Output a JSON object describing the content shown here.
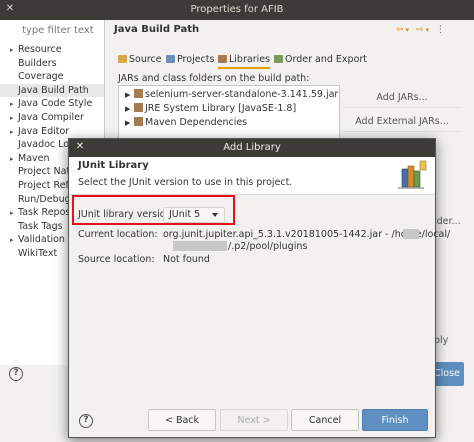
{
  "window": {
    "title": "Properties for AFIB",
    "filter_placeholder": "type filter text",
    "tree": [
      {
        "label": "Resource",
        "arrow": "▸"
      },
      {
        "label": "Builders",
        "arrow": ""
      },
      {
        "label": "Coverage",
        "arrow": ""
      },
      {
        "label": "Java Build Path",
        "arrow": "",
        "selected": true
      },
      {
        "label": "Java Code Style",
        "arrow": "▸"
      },
      {
        "label": "Java Compiler",
        "arrow": "▸"
      },
      {
        "label": "Java Editor",
        "arrow": "▸"
      },
      {
        "label": "Javadoc Locat",
        "arrow": ""
      },
      {
        "label": "Maven",
        "arrow": "▸"
      },
      {
        "label": "Project Natur",
        "arrow": ""
      },
      {
        "label": "Project Refer",
        "arrow": ""
      },
      {
        "label": "Run/Debug Se",
        "arrow": ""
      },
      {
        "label": "Task Reposito",
        "arrow": "▸"
      },
      {
        "label": "Task Tags",
        "arrow": ""
      },
      {
        "label": "Validation",
        "arrow": "▸"
      },
      {
        "label": "WikiText",
        "arrow": ""
      }
    ],
    "page_title": "Java Build Path",
    "tabs": [
      "Source",
      "Projects",
      "Libraries",
      "Order and Export"
    ],
    "active_tab": "Libraries",
    "jars_label": "JARs and class folders on the build path:",
    "jars": [
      {
        "label": "selenium-server-standalone-3.141.59.jar - /home/"
      },
      {
        "label": "JRE System Library [JavaSE-1.8]"
      },
      {
        "label": "Maven Dependencies"
      }
    ],
    "buttons": {
      "add_jars": "Add JARs...",
      "add_external_jars": "Add External JARs...",
      "partial_lder": "lder...",
      "partial_ply": "ply",
      "close": "Close"
    },
    "help": "?"
  },
  "dialog": {
    "title": "Add Library",
    "banner_title": "JUnit Library",
    "banner_desc": "Select the JUnit version to use in this project.",
    "version_label": "JUnit library version:",
    "version_value": "JUnit 5",
    "location_label": "Current location:",
    "location_line1": "org.junit.jupiter.api_5.3.1.v20181005-1442.jar - /home/local/",
    "location_line2": "/.p2/pool/plugins",
    "source_label": "Source location:",
    "source_value": "Not found",
    "help": "?",
    "back": "< Back",
    "next": "Next >",
    "cancel": "Cancel",
    "finish": "Finish"
  },
  "colors": {
    "titlebar": "#3c3b37",
    "accent_blue": "#5f8fc0",
    "highlight_red": "#e8101a",
    "tab_underline": "#e0a000"
  }
}
